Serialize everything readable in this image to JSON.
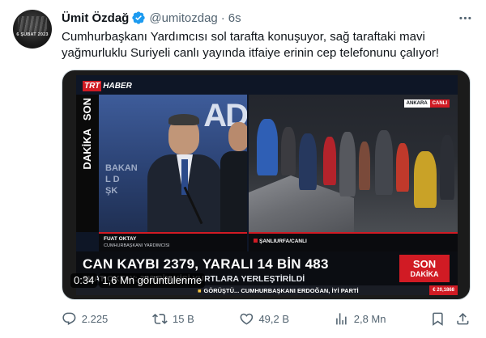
{
  "author": {
    "display_name": "Ümit Özdağ",
    "handle": "@umitozdag",
    "separator": "·",
    "time": "6s",
    "avatar_text": "6 ŞUBAT 2023"
  },
  "tweet": {
    "text": "Cumhurbaşkanı Yardımcısı sol tarafta konuşuyor, sağ taraftaki mavi yağmurluklu Suriyeli canlı yayında itfaiye erinin cep telefonunu çalıyor!"
  },
  "video": {
    "channel_trt": "TRT",
    "channel_haber": "HABER",
    "side_label_son": "SON",
    "side_label_dakika": "DAKİKA",
    "left_backdrop_text": "AD",
    "left_podium_lines": [
      "BAKAN",
      "L D",
      "ŞK"
    ],
    "live_city": "ANKARA",
    "live_label": "CANLI",
    "speaker_name": "FUAT OKTAY",
    "speaker_title": "CUMHURBAŞKANI YARDIMCISI",
    "location": "ŞANLIURFA/CANLI",
    "headline": "CAN KAYBI 2379, YARALI 14 BİN 483",
    "subheadline": "FUAT OKTAY: 338 BİN KİŞİ YURTLARA YERLEŞTİRİLDİ",
    "son_box_line1": "SON",
    "son_box_line2": "DAKİKA",
    "ticker": "GÖRÜŞTÜ... CUMHURBAŞKANI ERDOĞAN, İYİ PARTİ",
    "ticker_stock": "€ 20,1868",
    "elapsed": "0:34",
    "views": "1,6 Mn görüntülenme"
  },
  "actions": {
    "replies": "2.225",
    "reposts": "15 B",
    "likes": "49,2 B",
    "views": "2,8 Mn"
  },
  "colors": {
    "verified": "#1d9bf0",
    "trt_red": "#d11b24",
    "muted_text": "#536471"
  }
}
